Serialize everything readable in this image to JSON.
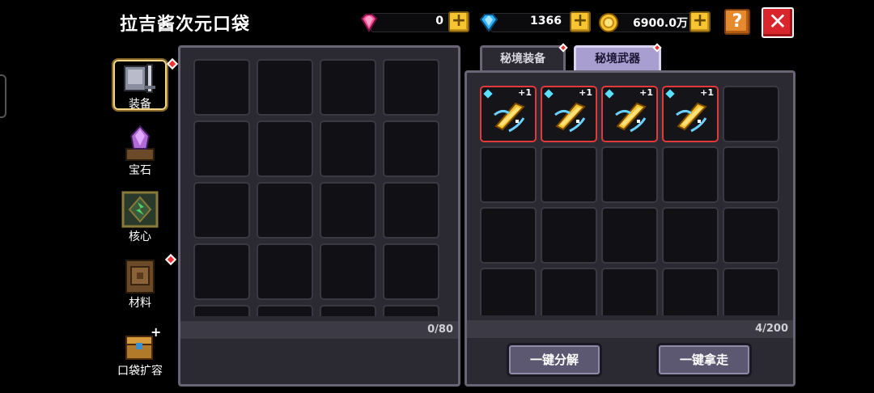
{
  "header": {
    "title": "拉吉酱次元口袋",
    "currencies": [
      {
        "icon": "pink-gem-icon",
        "value": "0",
        "color": "#ff4f9a"
      },
      {
        "icon": "blue-diamond-icon",
        "value": "1366",
        "color": "#2fb6ff"
      },
      {
        "icon": "gold-coin-icon",
        "value": "6900.0万",
        "color": "#f7c531"
      }
    ],
    "help_label": "?",
    "close_label": "✕"
  },
  "sidebar": {
    "items": [
      {
        "label": "装备",
        "icon": "armor-icon",
        "active": true,
        "badge": true
      },
      {
        "label": "宝石",
        "icon": "gem-icon",
        "active": false,
        "badge": false
      },
      {
        "label": "核心",
        "icon": "core-icon",
        "active": false,
        "badge": false
      },
      {
        "label": "材料",
        "icon": "material-icon",
        "active": false,
        "badge": true
      },
      {
        "label": "口袋扩容",
        "icon": "chest-icon",
        "active": false,
        "badge": false
      }
    ]
  },
  "left_panel": {
    "capacity": "0/80",
    "filled_slots": 0
  },
  "right_panel": {
    "tabs": [
      {
        "label": "秘境装备",
        "active": false,
        "badge": false
      },
      {
        "label": "秘境武器",
        "active": true,
        "badge": true
      }
    ],
    "capacity": "4/200",
    "items": [
      {
        "icon": "feather-blade-icon",
        "level": "+1"
      },
      {
        "icon": "feather-blade-icon",
        "level": "+1"
      },
      {
        "icon": "feather-blade-icon",
        "level": "+1"
      },
      {
        "icon": "feather-blade-icon",
        "level": "+1"
      }
    ],
    "buttons": {
      "decompose": "一键分解",
      "take_all": "一键拿走"
    }
  }
}
